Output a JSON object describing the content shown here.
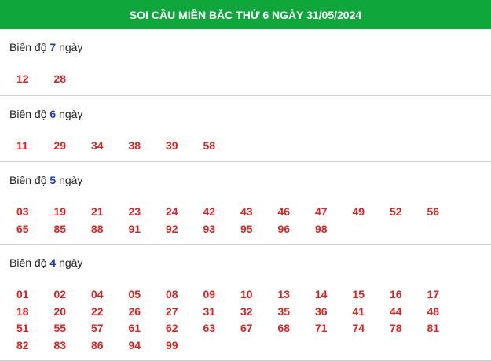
{
  "title": "SOI CẦU MIỀN BẮC THỨ 6 NGÀY 31/05/2024",
  "sections": [
    {
      "prefix": "Biên độ",
      "amplitude": "7",
      "suffix": "ngày",
      "numbers": [
        "12",
        "28"
      ]
    },
    {
      "prefix": "Biên độ",
      "amplitude": "6",
      "suffix": "ngày",
      "numbers": [
        "11",
        "29",
        "34",
        "38",
        "39",
        "58"
      ]
    },
    {
      "prefix": "Biên độ",
      "amplitude": "5",
      "suffix": "ngày",
      "numbers": [
        "03",
        "19",
        "21",
        "23",
        "24",
        "42",
        "43",
        "46",
        "47",
        "49",
        "52",
        "56",
        "65",
        "85",
        "88",
        "91",
        "92",
        "93",
        "95",
        "96",
        "98"
      ]
    },
    {
      "prefix": "Biên độ",
      "amplitude": "4",
      "suffix": "ngày",
      "numbers": [
        "01",
        "02",
        "04",
        "05",
        "08",
        "09",
        "10",
        "13",
        "14",
        "15",
        "16",
        "17",
        "18",
        "20",
        "22",
        "26",
        "27",
        "31",
        "32",
        "35",
        "36",
        "41",
        "44",
        "48",
        "51",
        "55",
        "57",
        "61",
        "62",
        "63",
        "67",
        "68",
        "71",
        "74",
        "78",
        "81",
        "82",
        "83",
        "86",
        "94",
        "99"
      ]
    }
  ],
  "colors": {
    "header_bg": "#0fa63c",
    "number": "#e0201e",
    "amplitude": "#1a3ad1"
  }
}
